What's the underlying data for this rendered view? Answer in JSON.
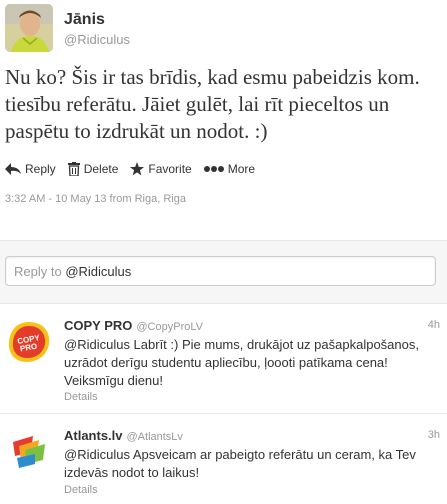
{
  "tweet": {
    "author_name": "Jānis",
    "author_handle": "@Ridiculus",
    "text": "Nu ko? Šis ir tas brīdis, kad esmu pabeidzis kom. tiesību referātu. Jāiet gulēt, lai rīt pieceltos un paspētu to izdrukāt un nodot. :)",
    "timestamp": "3:32 AM - 10 May 13 from Riga, Riga"
  },
  "actions": [
    {
      "label": "Reply",
      "icon": "reply-icon"
    },
    {
      "label": "Delete",
      "icon": "trash-icon"
    },
    {
      "label": "Favorite",
      "icon": "star-icon"
    },
    {
      "label": "More",
      "icon": "more-icon"
    }
  ],
  "reply_box": {
    "prefix": "Reply to ",
    "mention": "@Ridiculus"
  },
  "replies": [
    {
      "name": "COPY PRO",
      "handle": "@CopyProLV",
      "time": "4h",
      "text": "@Ridiculus Labrīt :) Pie mums, drukājot uz pašapkalpošanos, uzrādot derīgu studentu apliecību, ļoooti patīkama cena! Veiksmīgu dienu!",
      "details": "Details",
      "logo_text": "COPY PRO",
      "logo_color": "#e53b2a"
    },
    {
      "name": "Atlants.lv",
      "handle": "@AtlantsLv",
      "time": "3h",
      "text": "@Ridiculus Apsveicam ar pabeigto referātu un ceram, ka Tev izdevās nodot to laikus!",
      "details": "Details"
    }
  ]
}
